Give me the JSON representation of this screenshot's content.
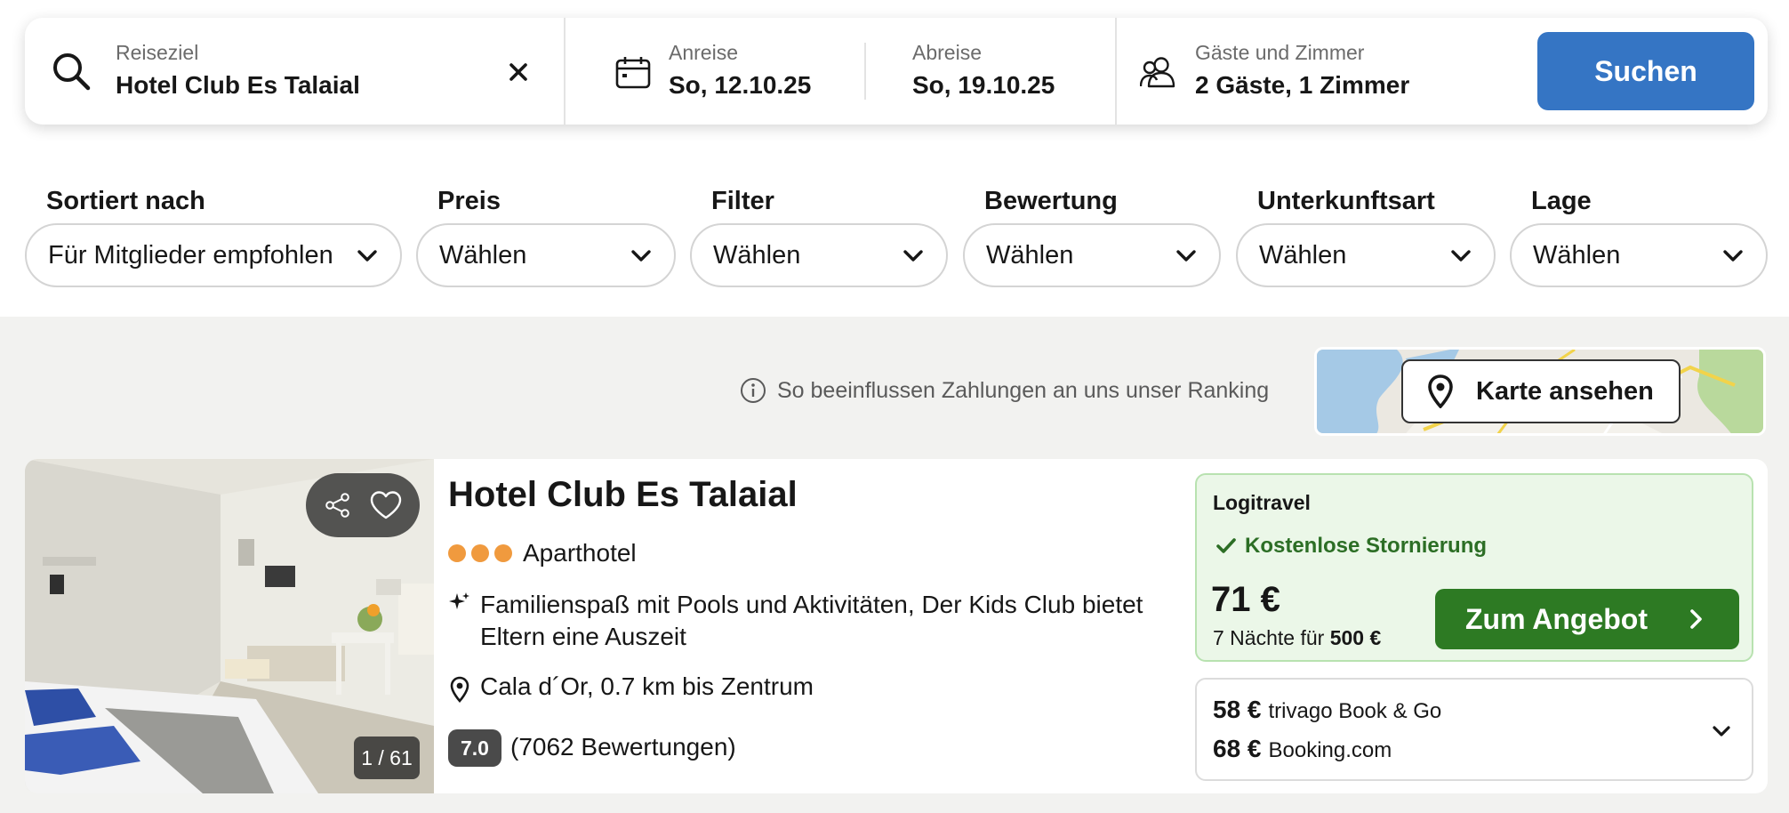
{
  "search": {
    "destination_label": "Reiseziel",
    "destination_value": "Hotel Club Es Talaial",
    "checkin_label": "Anreise",
    "checkin_value": "So, 12.10.25",
    "checkout_label": "Abreise",
    "checkout_value": "So, 19.10.25",
    "guests_label": "Gäste und Zimmer",
    "guests_value": "2 Gäste, 1 Zimmer",
    "search_button": "Suchen"
  },
  "filters": [
    {
      "label": "Sortiert nach",
      "value": "Für Mitglieder empfohlen"
    },
    {
      "label": "Preis",
      "value": "Wählen"
    },
    {
      "label": "Filter",
      "value": "Wählen"
    },
    {
      "label": "Bewertung",
      "value": "Wählen"
    },
    {
      "label": "Unterkunftsart",
      "value": "Wählen"
    },
    {
      "label": "Lage",
      "value": "Wählen"
    }
  ],
  "ranking_info": "So beeinflussen Zahlungen an uns unser Ranking",
  "map_button": "Karte ansehen",
  "hotel": {
    "name": "Hotel Club Es Talaial",
    "stars": 3,
    "type": "Aparthotel",
    "highlight": "Familienspaß mit Pools und Aktivitäten, Der Kids Club bietet Eltern eine Auszeit",
    "location": "Cala d´Or, 0.7 km bis Zentrum",
    "rating": "7.0",
    "reviews": "(7062 Bewertungen)",
    "photo_counter": "1 / 61"
  },
  "offer": {
    "partner": "Logitravel",
    "cancellation": "Kostenlose Stornierung",
    "price": "71 €",
    "nights_text": "7 Nächte für",
    "total": "500 €",
    "cta": "Zum Angebot"
  },
  "other_offers": [
    {
      "price": "58 €",
      "partner": "trivago Book & Go"
    },
    {
      "price": "68 €",
      "partner": "Booking.com"
    }
  ],
  "colors": {
    "primary_blue": "#3575c4",
    "cta_green": "#2d7a23",
    "offer_bg": "#ebf7e8",
    "star_orange": "#f09a3e"
  }
}
